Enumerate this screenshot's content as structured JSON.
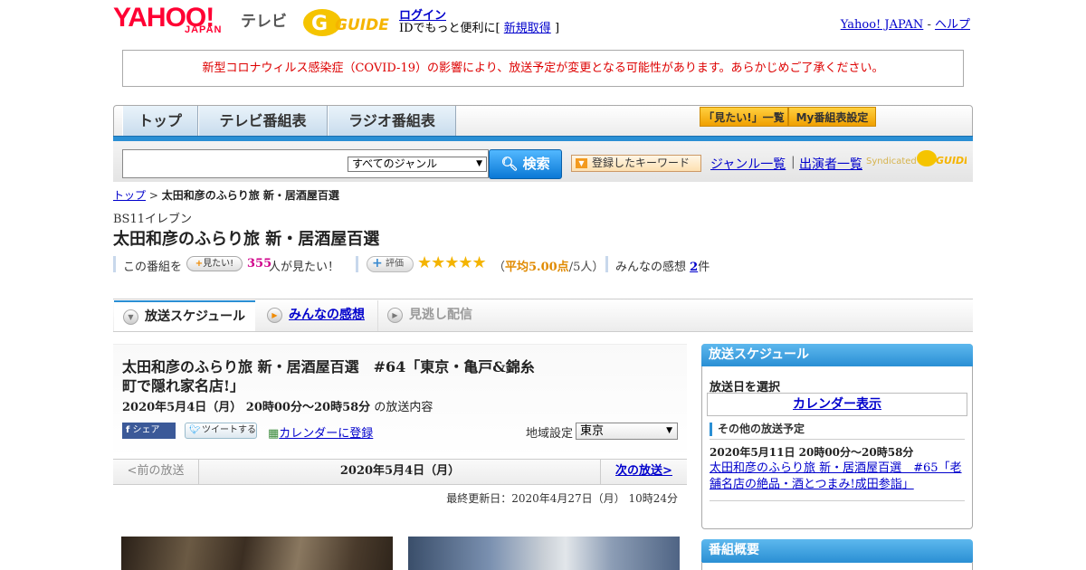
{
  "header": {
    "yahoo_logo": "YAHOO!",
    "yahoo_japan": "JAPAN",
    "tv_label": "テレビ",
    "gguide_logo": "GUIDE",
    "login": "ログイン",
    "login_sub_prefix": "IDでもっと便利に[",
    "signup": "新規取得",
    "login_sub_suffix": "]",
    "yahoo_japan_link": "Yahoo! JAPAN",
    "link_sep": " - ",
    "help_link": "ヘルプ"
  },
  "notice": "新型コロナウィルス感染症（COVID-19）の影響により、放送予定が変更となる可能性があります。あらかじめご了承ください。",
  "nav": {
    "tabs": [
      "トップ",
      "テレビ番組表",
      "ラジオ番組表"
    ],
    "mitai_list": "「見たい!」一覧",
    "my_settings": "My番組表設定"
  },
  "search": {
    "genre_selected": "すべてのジャンル",
    "button": "検索",
    "keyword_button": "登録したキーワード",
    "genre_list": "ジャンル一覧",
    "separator": "|",
    "performer_list": "出演者一覧",
    "syndicated": "Syndicated"
  },
  "breadcrumb": {
    "top": "トップ",
    "sep": " > ",
    "current": "太田和彦のふらり旅 新・居酒屋百選"
  },
  "program": {
    "channel": "BS11イレブン",
    "title": "太田和彦のふらり旅 新・居酒屋百選",
    "stats": {
      "prefix": "この番組を",
      "mitai_badge": "見たい!",
      "mitai_count": "355",
      "mitai_suffix": "人が見たい！",
      "rating_badge": "評価",
      "stars": "★★★★★",
      "avg_open": "（",
      "avg_value": "平均5.00点",
      "avg_count": "/5人）",
      "impressions_prefix": "みんなの感想 ",
      "impressions_count": "2",
      "impressions_suffix": "件"
    }
  },
  "tabs": {
    "schedule": "放送スケジュール",
    "impressions": "みんなの感想",
    "missed": "見逃し配信"
  },
  "episode": {
    "title": "太田和彦のふらり旅 新・居酒屋百選　#64「東京・亀戸&錦糸町で隠れ家名店!」",
    "datetime": "2020年5月4日（月）  20時00分～20時58分",
    "suffix": "の放送内容",
    "share_fb": "シェア",
    "share_tw": "ツイートする",
    "calendar_register": "カレンダーに登録",
    "region_label": "地域設定",
    "region_value": "東京"
  },
  "date_nav": {
    "prev": "<前の放送",
    "current": "2020年5月4日（月）",
    "next": "次の放送>"
  },
  "updated": "最終更新日：2020年4月27日（月）  10時24分",
  "sidebar": {
    "schedule_head": "放送スケジュール",
    "select_date": "放送日を選択",
    "calendar_button": "カレンダー表示",
    "other_head": "その他の放送予定",
    "other_time": "2020年5月11日  20時00分～20時58分",
    "other_link": "太田和彦のふらり旅 新・居酒屋百選　#65「老舗名店の絶品・酒とつまみ!成田参詣」",
    "overview_head": "番組概要"
  }
}
